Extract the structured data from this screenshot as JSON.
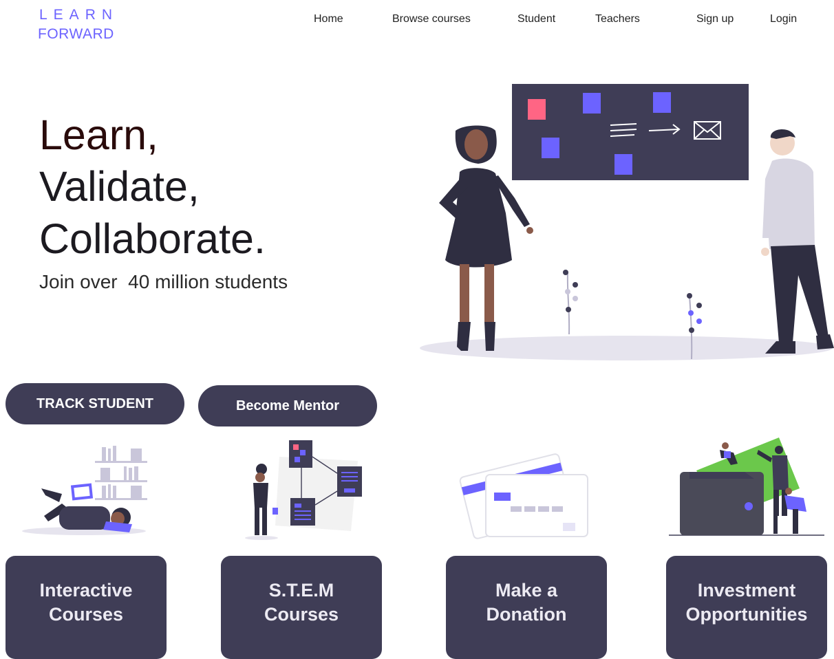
{
  "logo": {
    "line1": "LEARN",
    "line2": "FORWARD"
  },
  "nav": {
    "home": "Home",
    "browse": "Browse courses",
    "student": "Student",
    "teachers": "Teachers",
    "signup": "Sign up",
    "login": "Login"
  },
  "hero": {
    "line1": "Learn,",
    "line2": "Validate,",
    "line3": "Collaborate.",
    "subtitle": "Join over  40 million students"
  },
  "actions": {
    "track": "TRACK STUDENT",
    "mentor": "Become Mentor"
  },
  "cards": [
    {
      "label": "Interactive\nCourses"
    },
    {
      "label": "S.T.E.M\nCourses"
    },
    {
      "label": "Make a\nDonation"
    },
    {
      "label": "Investment\nOpportunities"
    }
  ],
  "colors": {
    "accent": "#6c63ff",
    "dark": "#3f3d56",
    "pink": "#ff6584",
    "ground": "#e6e4ee",
    "green": "#6bc84b"
  },
  "icons": [
    "presentation-illustration",
    "reading-illustration",
    "flowchart-illustration",
    "credit-card-illustration",
    "wallet-illustration",
    "envelope-icon",
    "arrow-icon"
  ]
}
